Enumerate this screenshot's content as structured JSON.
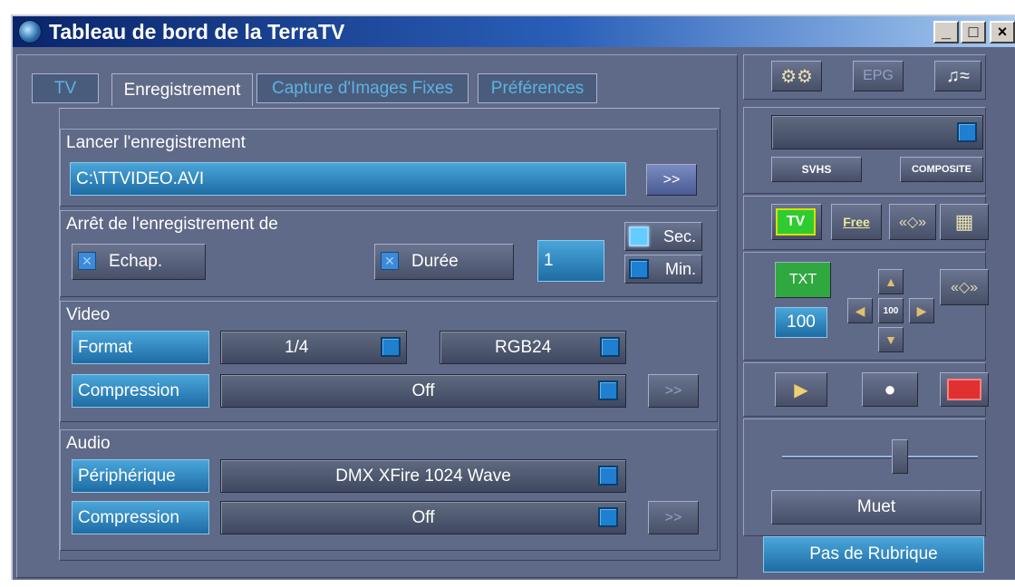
{
  "window": {
    "title": "Tableau de bord de la TerraTV",
    "minimize": "_",
    "maximize": "□",
    "close": "×"
  },
  "tabs": [
    "TV",
    "Enregistrement",
    "Capture d'Images Fixes",
    "Préférences"
  ],
  "record": {
    "group_title": "Lancer l'enregistrement",
    "file_path": "C:\\TTVIDEO.AVI",
    "browse": ">>"
  },
  "stop": {
    "group_title": "Arrêt de l'enregistrement de",
    "escape_label": "Echap.",
    "duration_label": "Durée",
    "duration_value": "1",
    "sec_label": "Sec.",
    "min_label": "Min."
  },
  "video": {
    "group_title": "Video",
    "format_label": "Format",
    "format_size": "1/4",
    "format_color": "RGB24",
    "compression_label": "Compression",
    "compression_value": "Off",
    "more": ">>"
  },
  "audio": {
    "group_title": "Audio",
    "device_label": "Périphérique",
    "device_value": "DMX XFire 1024 Wave",
    "compression_label": "Compression",
    "compression_value": "Off",
    "more": ">>"
  },
  "right": {
    "epg": "EPG",
    "svhs": "SVHS",
    "composite": "COMPOSITE",
    "tv": "TV",
    "free": "Free",
    "txt": "TXT",
    "zoom_center": "100",
    "zoom_value": "100",
    "mute": "Muet",
    "volume_level": 0.6,
    "status": "Pas de Rubrique"
  },
  "colors": {
    "accent": "#1e6ca4",
    "panel": "#5f6988",
    "record_red": "#e03030",
    "tv_green": "#2fcc30"
  }
}
